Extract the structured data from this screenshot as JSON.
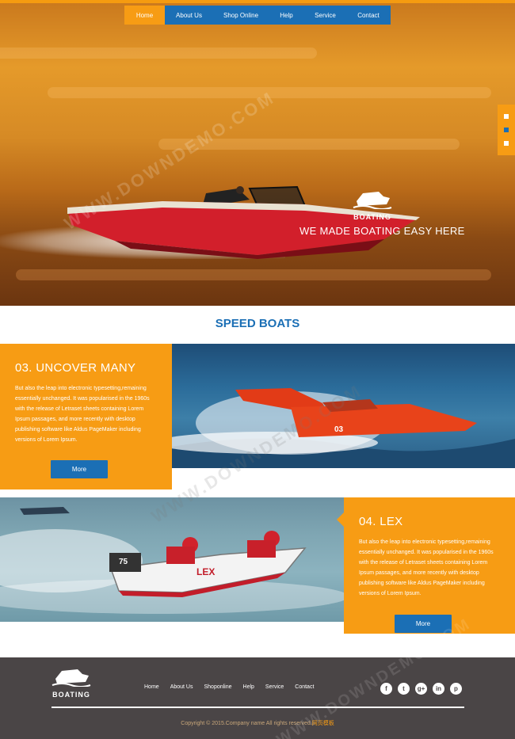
{
  "nav": {
    "items": [
      "Home",
      "About Us",
      "Shop Online",
      "Help",
      "Service",
      "Contact"
    ],
    "active_index": 0
  },
  "hero": {
    "logo_text": "BOATING",
    "tagline": "WE MADE BOATING EASY HERE",
    "slider_dots": 3,
    "active_dot": 1
  },
  "section": {
    "title": "SPEED BOATS"
  },
  "feature1": {
    "title": "03. UNCOVER MANY",
    "text": "But also the leap into electronic typesetting,remaining essentially unchanged. It was popularised in the 1960s with the release of Letraset sheets containing Lorem Ipsum passages, and more recently with desktop publishing software like Aldus PageMaker including versions of Lorem Ipsum.",
    "button": "More",
    "boat_label": "03"
  },
  "feature2": {
    "title": "04. LEX",
    "text": "But also the leap into electronic typesetting,remaining essentially unchanged. It was popularised in the 1960s with the release of Letraset sheets containing Lorem Ipsum passages, and more recently with desktop publishing software like Aldus PageMaker including versions of Lorem Ipsum.",
    "button": "More",
    "boat_label": "LEX",
    "boat_number": "75"
  },
  "footer": {
    "logo_text": "BOATING",
    "nav": [
      "Home",
      "About Us",
      "Shoponline",
      "Help",
      "Service",
      "Contact"
    ],
    "social": [
      "facebook-icon",
      "twitter-icon",
      "google-plus-icon",
      "linkedin-icon",
      "pinterest-icon"
    ],
    "social_glyphs": [
      "f",
      "t",
      "g+",
      "in",
      "p"
    ],
    "copyright": "Copyright © 2015.Company name All rights reserved.",
    "copyright_link": "网页模板"
  },
  "colors": {
    "accent": "#f79c14",
    "brand_blue": "#1b6fb5",
    "footer_bg": "#4a4546"
  }
}
